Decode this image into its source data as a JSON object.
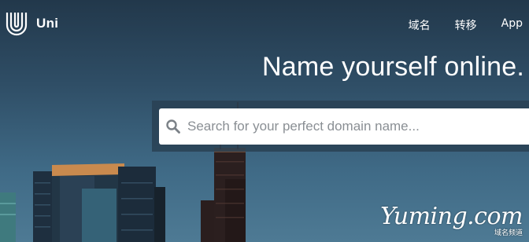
{
  "header": {
    "logo_text": "Uni",
    "logo_icon": "uni-u-logo-icon",
    "nav": [
      {
        "label": "域名"
      },
      {
        "label": "转移"
      },
      {
        "label": "App"
      }
    ]
  },
  "hero": {
    "headline": "Name yourself online.",
    "search": {
      "placeholder": "Search for your perfect domain name...",
      "value": "",
      "icon": "search-icon"
    }
  },
  "watermark": {
    "brand": "Yuming.com",
    "subtitle": "域名频道"
  },
  "colors": {
    "text": "#ffffff",
    "search_panel": "#283f52",
    "placeholder": "#8a8f94"
  }
}
